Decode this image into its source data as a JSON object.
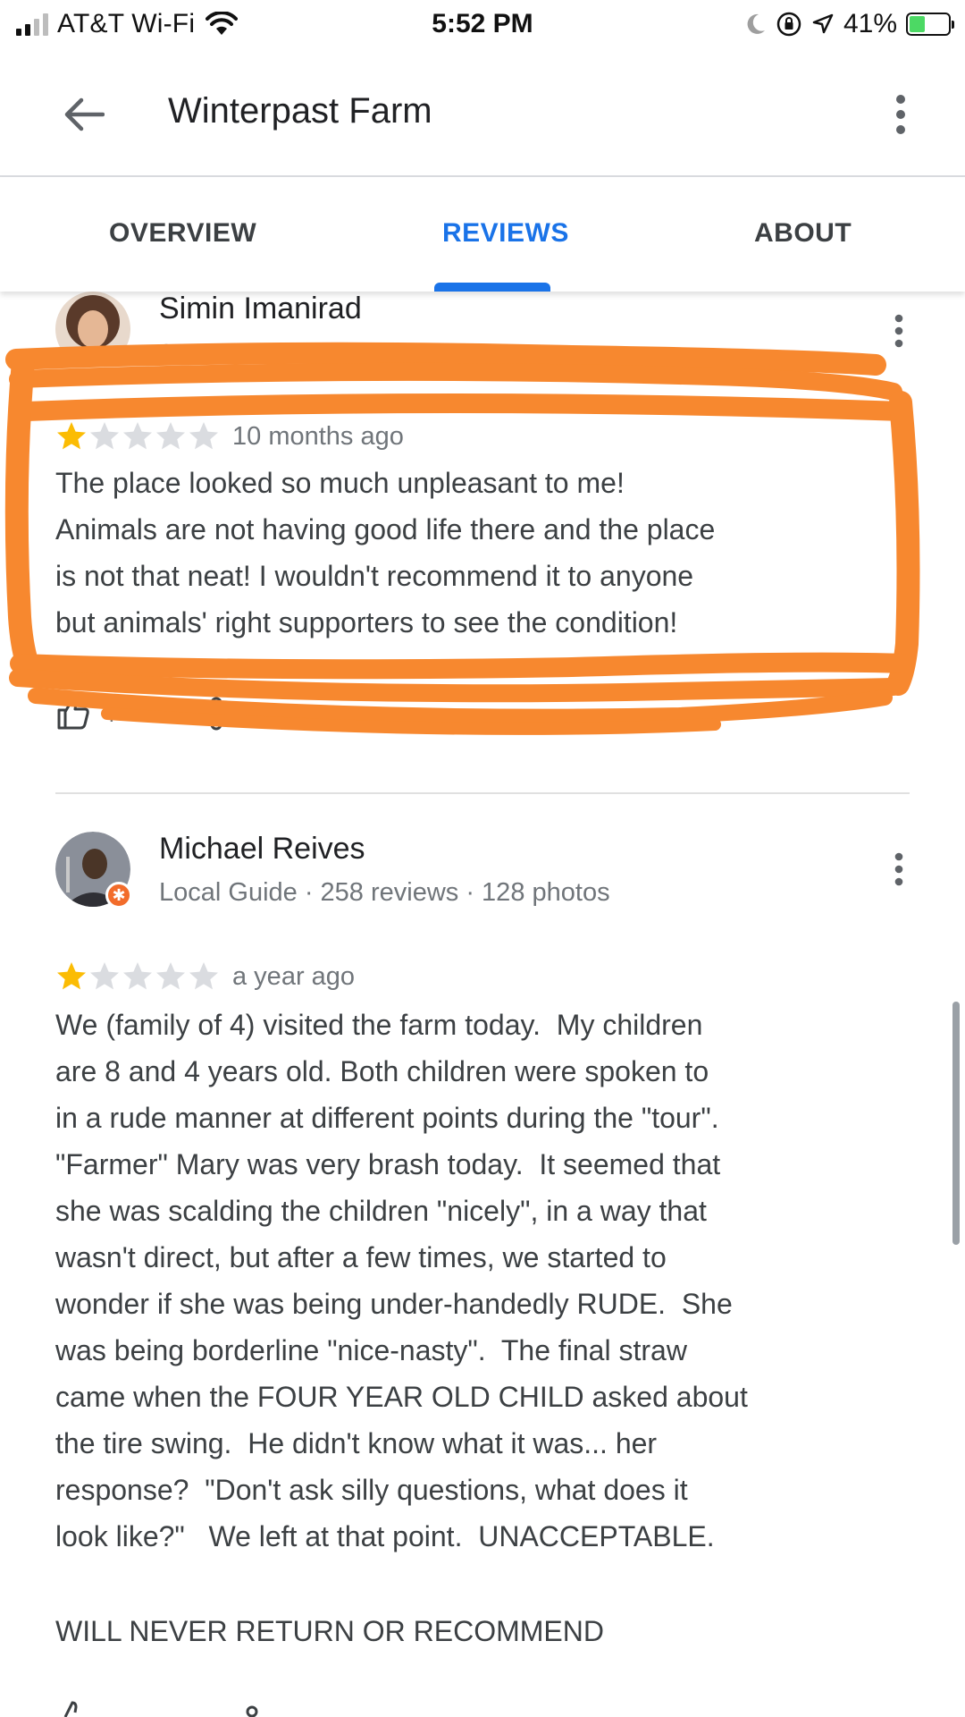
{
  "status_bar": {
    "carrier": "AT&T Wi-Fi",
    "time": "5:52 PM",
    "battery_percent": "41%",
    "battery_level": 0.41,
    "icons": [
      "signal-icon",
      "wifi-icon",
      "moon-icon",
      "orientation-lock-icon",
      "location-icon",
      "battery-icon"
    ]
  },
  "app_bar": {
    "title": "Winterpast Farm",
    "icons": [
      "back-arrow-icon",
      "more-vert-icon"
    ]
  },
  "tabs": [
    {
      "label": "OVERVIEW",
      "active": false
    },
    {
      "label": "REVIEWS",
      "active": true
    },
    {
      "label": "ABOUT",
      "active": false
    }
  ],
  "reviews": [
    {
      "name": "Simin Imanirad",
      "meta": "3 reviews",
      "rating": 1,
      "max_rating": 5,
      "date": "10 months ago",
      "text": "The place looked so much unpleasant to me!\nAnimals are not having good life there and the place\nis not that neat! I wouldn't recommend it to anyone\nbut animals' right supporters to see the condition!",
      "likes": "4"
    },
    {
      "name": "Michael Reives",
      "meta": "Local Guide · 258 reviews · 128 photos",
      "rating": 1,
      "max_rating": 5,
      "date": "a year ago",
      "text": "We (family of 4) visited the farm today.  My children\nare 8 and 4 years old. Both children were spoken to\nin a rude manner at different points during the \"tour\".\n\"Farmer\" Mary was very brash today.  It seemed that\nshe was scalding the children \"nicely\", in a way that\nwasn't direct, but after a few times, we started to\nwonder if she was being under-handedly RUDE.  She\nwas being borderline \"nice-nasty\".  The final straw\ncame when the FOUR YEAR OLD CHILD asked about\nthe tire swing.  He didn't know what it was... her\nresponse?  \"Don't ask silly questions, what does it\nlook like?\"   We left at that point.  UNACCEPTABLE.",
      "closing": "WILL NEVER RETURN OR RECOMMEND"
    }
  ],
  "colors": {
    "accent": "#1a73e8",
    "star_filled": "#fbbc04",
    "star_empty": "#dadce0",
    "annotation": "#f7882f"
  }
}
